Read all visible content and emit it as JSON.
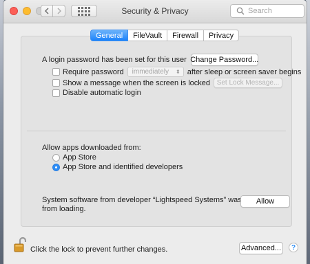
{
  "window": {
    "title": "Security & Privacy"
  },
  "toolbar": {
    "back_icon": "chevron-left-icon",
    "forward_icon": "chevron-right-icon",
    "grid_icon": "show-all-grid-icon"
  },
  "search": {
    "placeholder": "Search"
  },
  "tabs": [
    {
      "label": "General",
      "selected": true
    },
    {
      "label": "FileVault",
      "selected": false
    },
    {
      "label": "Firewall",
      "selected": false
    },
    {
      "label": "Privacy",
      "selected": false
    }
  ],
  "general": {
    "login_status": "A login password has been set for this user",
    "change_password_label": "Change Password...",
    "require_password": {
      "label": "Require password",
      "checked": false,
      "interval": "immediately",
      "suffix": "after sleep or screen saver begins"
    },
    "show_message": {
      "label": "Show a message when the screen is locked",
      "checked": false,
      "button_label": "Set Lock Message..."
    },
    "disable_auto_login": {
      "label": "Disable automatic login",
      "checked": false
    }
  },
  "downloads": {
    "heading": "Allow apps downloaded from:",
    "options": [
      {
        "label": "App Store",
        "selected": false
      },
      {
        "label": "App Store and identified developers",
        "selected": true
      }
    ]
  },
  "blocked": {
    "message_line1": "System software from developer “Lightspeed Systems” was blocked",
    "message_line2": "from loading.",
    "allow_label": "Allow"
  },
  "footer": {
    "lock_text": "Click the lock to prevent further changes.",
    "advanced_label": "Advanced...",
    "help_label": "?"
  },
  "colors": {
    "accent": "#1a82fb",
    "close": "#fc5f57",
    "minimize": "#fdbc2e"
  }
}
